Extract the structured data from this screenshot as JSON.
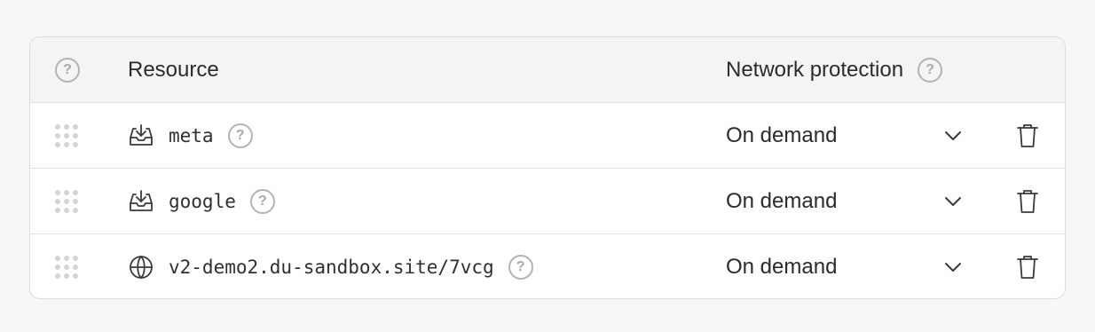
{
  "header": {
    "resource_label": "Resource",
    "protection_label": "Network protection",
    "help_glyph": "?"
  },
  "rows": [
    {
      "name": "meta",
      "icon": "inbox-download-icon",
      "protection": "On demand",
      "help_glyph": "?"
    },
    {
      "name": "google",
      "icon": "inbox-download-icon",
      "protection": "On demand",
      "help_glyph": "?"
    },
    {
      "name": "v2-demo2.du-sandbox.site/7vcg",
      "icon": "globe-icon",
      "protection": "On demand",
      "help_glyph": "?"
    }
  ],
  "colors": {
    "border": "#dcdcdf",
    "header_bg": "#f4f4f5",
    "text": "#2b2b2e",
    "muted_icon": "#b3b3b8"
  }
}
